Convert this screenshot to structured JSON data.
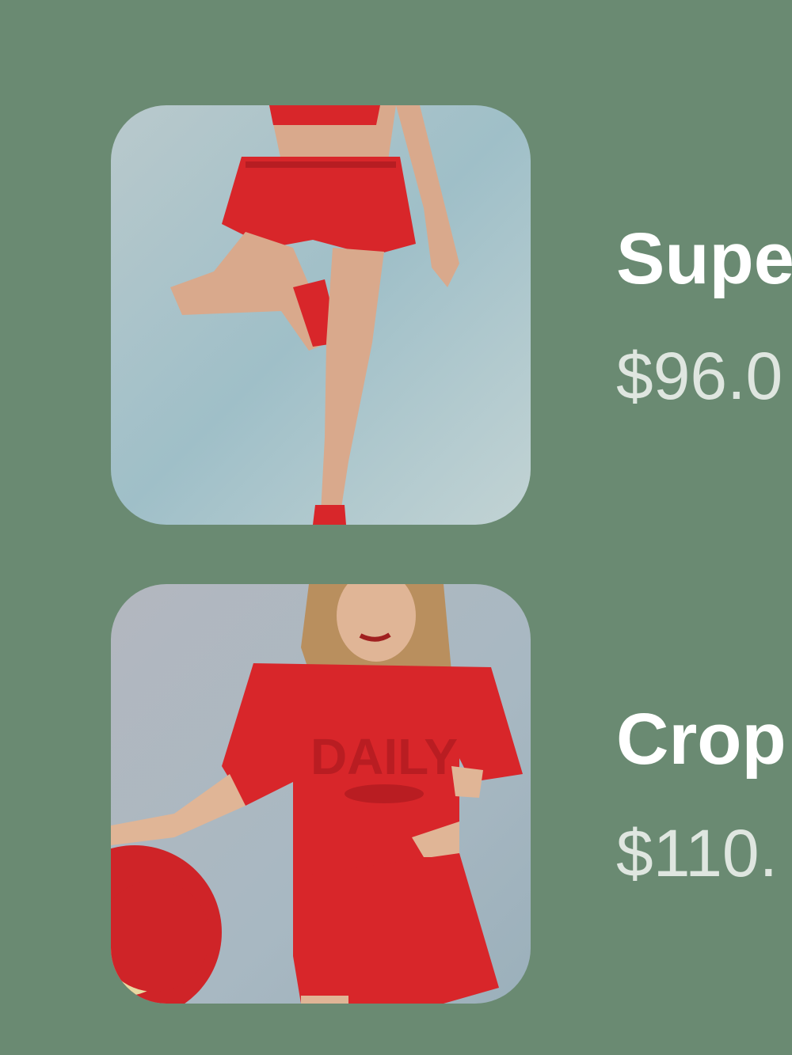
{
  "colors": {
    "background": "#6a8a72",
    "name_text": "#ffffff",
    "price_text": "#dfe6e0",
    "garment_red": "#d8262a"
  },
  "products": [
    {
      "name": "Supe",
      "price": "$96.0",
      "image_icon": "product-photo-red-shorts"
    },
    {
      "name": "Crop",
      "price": "$110.",
      "image_icon": "product-photo-red-tee-shorts",
      "print_text": "DAILY"
    }
  ]
}
